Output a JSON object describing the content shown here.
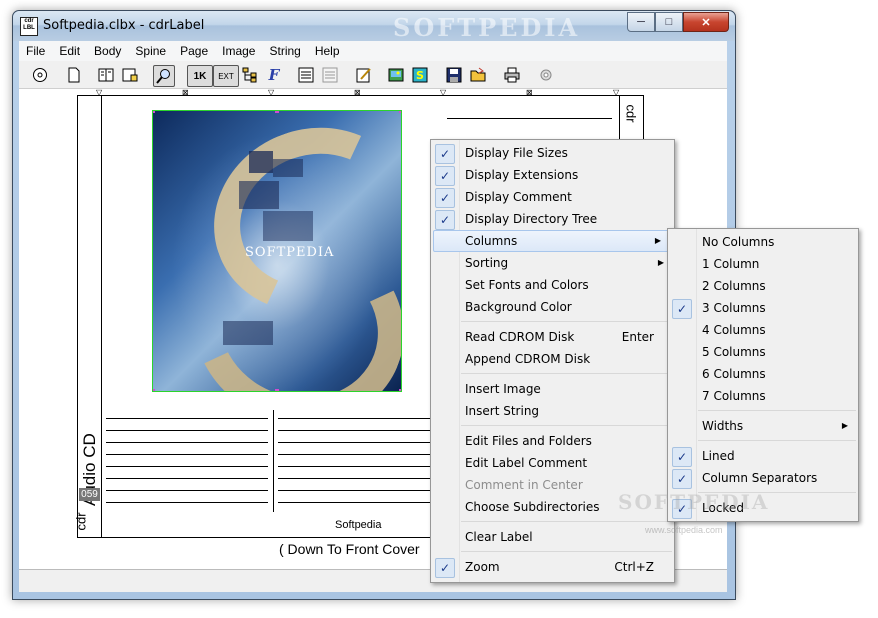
{
  "window": {
    "title": "Softpedia.clbx - cdrLabel",
    "watermark": "SOFTPEDIA",
    "app_icon_text": "cdr LABEL"
  },
  "menubar": [
    "File",
    "Edit",
    "Body",
    "Spine",
    "Page",
    "Image",
    "String",
    "Help"
  ],
  "toolbar": {
    "items": [
      "disc-icon",
      "new-page-icon",
      "book-icon",
      "book-add-icon",
      "zoom-icon",
      "1K",
      "EXT",
      "tree-icon",
      "font-icon",
      "list-icon",
      "list-gray-icon",
      "edit-icon",
      "image-icon",
      "image-s-icon",
      "save-icon",
      "open-folder-icon",
      "print-icon",
      "settings-icon"
    ],
    "one_k_label": "1K",
    "ext_label": "EXT"
  },
  "label": {
    "spine_title": "Audio CD",
    "spine_number": "059",
    "spine_cdr": "cdr",
    "right_cdr": "cdr",
    "image_caption": "SOFTPEDIA",
    "footer_text": "Softpedia",
    "down_cover_text": "( Down To Front Cover"
  },
  "context_menu": {
    "items": [
      {
        "label": "Display File Sizes",
        "checked": true
      },
      {
        "label": "Display Extensions",
        "checked": true
      },
      {
        "label": "Display Comment",
        "checked": true
      },
      {
        "label": "Display Directory Tree",
        "checked": true
      },
      {
        "label": "Columns",
        "submenu": true,
        "highlighted": true
      },
      {
        "label": "Sorting",
        "submenu": true
      },
      {
        "label": "Set Fonts and Colors"
      },
      {
        "label": "Background Color"
      },
      {
        "separator": true
      },
      {
        "label": "Read CDROM Disk",
        "shortcut": "Enter"
      },
      {
        "label": "Append CDROM Disk"
      },
      {
        "separator": true
      },
      {
        "label": "Insert Image"
      },
      {
        "label": "Insert String"
      },
      {
        "separator": true
      },
      {
        "label": "Edit Files and Folders"
      },
      {
        "label": "Edit Label Comment"
      },
      {
        "label": "Comment in Center",
        "disabled": true
      },
      {
        "label": "Choose Subdirectories"
      },
      {
        "separator": true
      },
      {
        "label": "Clear Label"
      },
      {
        "separator": true
      },
      {
        "label": "Zoom",
        "shortcut": "Ctrl+Z",
        "checked": true
      }
    ]
  },
  "columns_submenu": {
    "items": [
      {
        "label": "No Columns"
      },
      {
        "label": "1 Column"
      },
      {
        "label": "2 Columns"
      },
      {
        "label": "3 Columns",
        "checked": true
      },
      {
        "label": "4 Columns"
      },
      {
        "label": "5 Columns"
      },
      {
        "label": "6 Columns"
      },
      {
        "label": "7 Columns"
      },
      {
        "separator": true
      },
      {
        "label": "Widths",
        "submenu": true
      },
      {
        "separator": true
      },
      {
        "label": "Lined",
        "checked": true
      },
      {
        "label": "Column Separators",
        "checked": true
      },
      {
        "separator": true
      },
      {
        "label": "Locked",
        "checked": true
      }
    ]
  },
  "watermark": {
    "text": "SOFTPEDIA",
    "url": "www.softpedia.com"
  }
}
